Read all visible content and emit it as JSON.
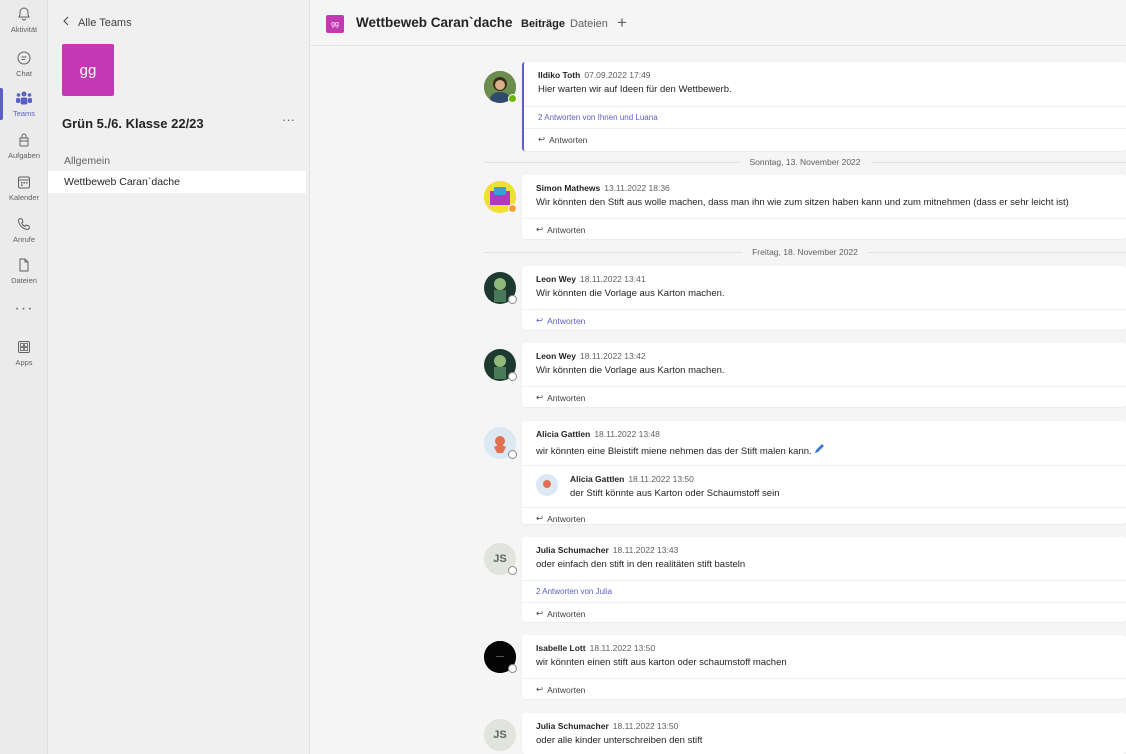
{
  "rail": {
    "items": [
      {
        "label": "Aktivität",
        "icon": "bell-icon"
      },
      {
        "label": "Chat",
        "icon": "chat-icon"
      },
      {
        "label": "Teams",
        "icon": "teams-icon"
      },
      {
        "label": "Aufgaben",
        "icon": "assignments-icon"
      },
      {
        "label": "Kalender",
        "icon": "calendar-icon"
      },
      {
        "label": "Anrufe",
        "icon": "phone-icon"
      },
      {
        "label": "Dateien",
        "icon": "file-icon"
      },
      {
        "label": "Apps",
        "icon": "apps-icon"
      }
    ],
    "more": "···",
    "accent": "#5b5fc7"
  },
  "teampanel": {
    "back_label": "Alle Teams",
    "team_initials": "gg",
    "team_name": "Grün 5./6. Klasse 22/23",
    "more": "···",
    "channels": [
      "Allgemein",
      "Wettbeweb Caran`dache"
    ],
    "team_color": "#c239b3"
  },
  "header": {
    "channel_initials": "gg",
    "channel_title": "Wettbeweb Caran`dache",
    "tabs": [
      "Beiträge",
      "Dateien"
    ],
    "add_tab": "+"
  },
  "dividers": [
    "Sonntag, 13. November 2022",
    "Freitag, 18. November 2022"
  ],
  "messages": [
    {
      "author": "Ildiko Toth",
      "time": "07.09.2022 17:49",
      "text": "Hier warten wir auf Ideen für den Wettbewerb.",
      "replies": "2 Antworten von Ihnen und Luana",
      "reply_label": "Antworten"
    },
    {
      "author": "Simon Mathews",
      "time": "13.11.2022 18:36",
      "text": "Wir könnten den Stift aus wolle machen, dass man ihn wie zum sitzen haben kann und zum mitnehmen (dass er sehr leicht ist)",
      "reply_label": "Antworten"
    },
    {
      "author": "Leon Wey",
      "time": "18.11.2022 13:41",
      "text": "Wir könnten die Vorlage aus Karton machen.",
      "reply_label": "Antworten"
    },
    {
      "author": "Leon Wey",
      "time": "18.11.2022 13:42",
      "text": "Wir könnten die Vorlage aus Karton machen.",
      "reply_label": "Antworten"
    },
    {
      "author": "Alicia Gattlen",
      "time": "18.11.2022 13:48",
      "text": "wir könnten eine Bleistift miene nehmen das der Stift malen kann.",
      "nested": {
        "author": "Alicia Gattlen",
        "time": "18.11.2022 13:50",
        "text": "der Stift könnte aus Karton oder Schaumstoff sein"
      },
      "reply_label": "Antworten"
    },
    {
      "author": "Julia Schumacher",
      "initials": "JS",
      "time": "18.11.2022 13:43",
      "text": "oder einfach den stift in den realitäten stift basteln",
      "replies": "2 Antworten von Julia",
      "reply_label": "Antworten"
    },
    {
      "author": "Isabelle Lott",
      "time": "18.11.2022 13:50",
      "text": "wir könnten einen stift aus karton oder schaumstoff machen",
      "reply_label": "Antworten"
    },
    {
      "author": "Julia Schumacher",
      "initials": "JS",
      "time": "18.11.2022 13:50",
      "text": "oder alle kinder unterschreiben den stift"
    }
  ]
}
